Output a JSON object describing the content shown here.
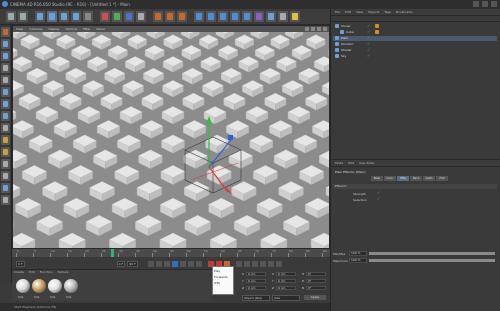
{
  "app": {
    "title": "CINEMA 4D R16.050 Studio (RC - R16) - [Untitled 1 *] - Main"
  },
  "toolbar": {
    "icons": [
      "undo-icon",
      "redo-icon",
      "live-selection-icon",
      "move-icon",
      "scale-icon",
      "rotate-icon",
      "recent-tools-icon",
      "x-axis-icon",
      "y-axis-icon",
      "z-axis-icon",
      "coordinate-system-icon",
      "render-view-icon",
      "render-picture-viewer-icon",
      "render-settings-icon",
      "cube-icon",
      "subdivision-icon",
      "array-icon",
      "spline-icon",
      "nurbs-icon",
      "deformer-icon",
      "scene-icon",
      "camera-icon",
      "light-icon"
    ]
  },
  "viewport": {
    "menu": [
      "View",
      "Cameras",
      "Display",
      "Options",
      "Filter",
      "Panel"
    ],
    "background": "#8c8c8c"
  },
  "timeline": {
    "ticks": [
      "0",
      "5",
      "10",
      "15",
      "20",
      "25",
      "30",
      "35",
      "40",
      "45",
      "50",
      "55",
      "60",
      "65",
      "70",
      "75",
      "80",
      "85",
      "90"
    ],
    "current_frame": "0 F",
    "start": "0 F",
    "end": "90 F",
    "min": "0 F",
    "max": "90 F"
  },
  "materials": {
    "menu": [
      "Create",
      "Edit",
      "Function",
      "Texture"
    ],
    "items": [
      {
        "label": "Mat",
        "color": "#d9d9d9"
      },
      {
        "label": "Mat",
        "color": "#c9a060"
      },
      {
        "label": "Mat",
        "color": "#e0e0e0"
      },
      {
        "label": "Mat",
        "color": "#b8b8b8"
      }
    ]
  },
  "tooltip": {
    "lines": [
      "Play",
      "Forwards",
      "(F8)"
    ]
  },
  "coords": {
    "rows": [
      {
        "a": "X",
        "av": "0 cm",
        "b": "X",
        "bv": "0 cm",
        "c": "H",
        "cv": "0°"
      },
      {
        "a": "Y",
        "av": "0 cm",
        "b": "Y",
        "bv": "0 cm",
        "c": "P",
        "cv": "0°"
      },
      {
        "a": "Z",
        "av": "0 cm",
        "b": "Z",
        "bv": "0 cm",
        "c": "B",
        "cv": "0°"
      }
    ],
    "mode1": "Object (Rel)",
    "mode2": "Size",
    "apply": "Apply"
  },
  "object_manager": {
    "menu": [
      "File",
      "Edit",
      "View",
      "Objects",
      "Tags",
      "Bookmarks"
    ],
    "rows": [
      {
        "name": "Cloner",
        "indent": 0
      },
      {
        "name": "Cube",
        "indent": 1
      },
      {
        "name": "Plain",
        "indent": 0
      },
      {
        "name": "Random",
        "indent": 0
      },
      {
        "name": "Shader",
        "indent": 0
      },
      {
        "name": "Sky",
        "indent": 0
      }
    ]
  },
  "attribute_manager": {
    "menu": [
      "Mode",
      "Edit",
      "User Data"
    ],
    "title": "Plain Effector [Plain]",
    "tabs": [
      "Basic",
      "Coord.",
      "Effector",
      "Parameter",
      "Deformer",
      "Falloff"
    ],
    "section": "Effector",
    "attrs": [
      {
        "label": "Strength",
        "value": "✓"
      },
      {
        "label": "Selection",
        "value": "✓"
      }
    ],
    "sliders": [
      {
        "label": "Min/Max",
        "value": "100 %",
        "fill": 1.0
      },
      {
        "label": "Maximum",
        "value": "100 %",
        "fill": 1.0
      }
    ]
  },
  "status": {
    "text": "Start Playback [Shortcut F8]"
  }
}
